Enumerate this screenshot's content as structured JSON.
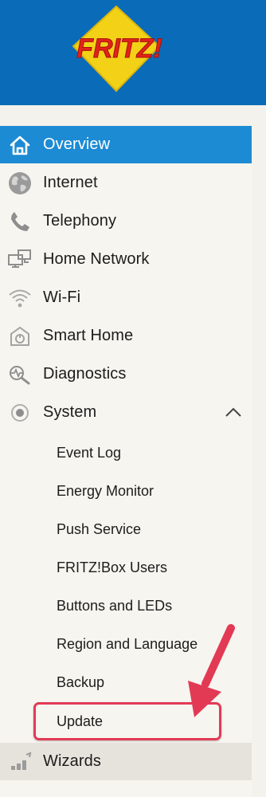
{
  "header": {
    "logo_text": "FRITZ!"
  },
  "nav": {
    "items": [
      {
        "label": "Overview",
        "icon": "home-icon",
        "active": true
      },
      {
        "label": "Internet",
        "icon": "globe-icon"
      },
      {
        "label": "Telephony",
        "icon": "phone-icon"
      },
      {
        "label": "Home Network",
        "icon": "network-icon"
      },
      {
        "label": "Wi-Fi",
        "icon": "wifi-icon"
      },
      {
        "label": "Smart Home",
        "icon": "smart-home-icon"
      },
      {
        "label": "Diagnostics",
        "icon": "diagnostics-icon"
      },
      {
        "label": "System",
        "icon": "system-icon",
        "expanded": true
      }
    ],
    "system_subitems": [
      {
        "label": "Event Log"
      },
      {
        "label": "Energy Monitor"
      },
      {
        "label": "Push Service"
      },
      {
        "label": "FRITZ!Box Users"
      },
      {
        "label": "Buttons and LEDs"
      },
      {
        "label": "Region and Language"
      },
      {
        "label": "Backup"
      },
      {
        "label": "Update",
        "highlighted": true
      }
    ],
    "wizards": {
      "label": "Wizards",
      "icon": "wizards-icon"
    }
  },
  "colors": {
    "header_bg": "#0a6bb8",
    "active_bg": "#1c8bd4",
    "highlight": "#e23a55"
  }
}
